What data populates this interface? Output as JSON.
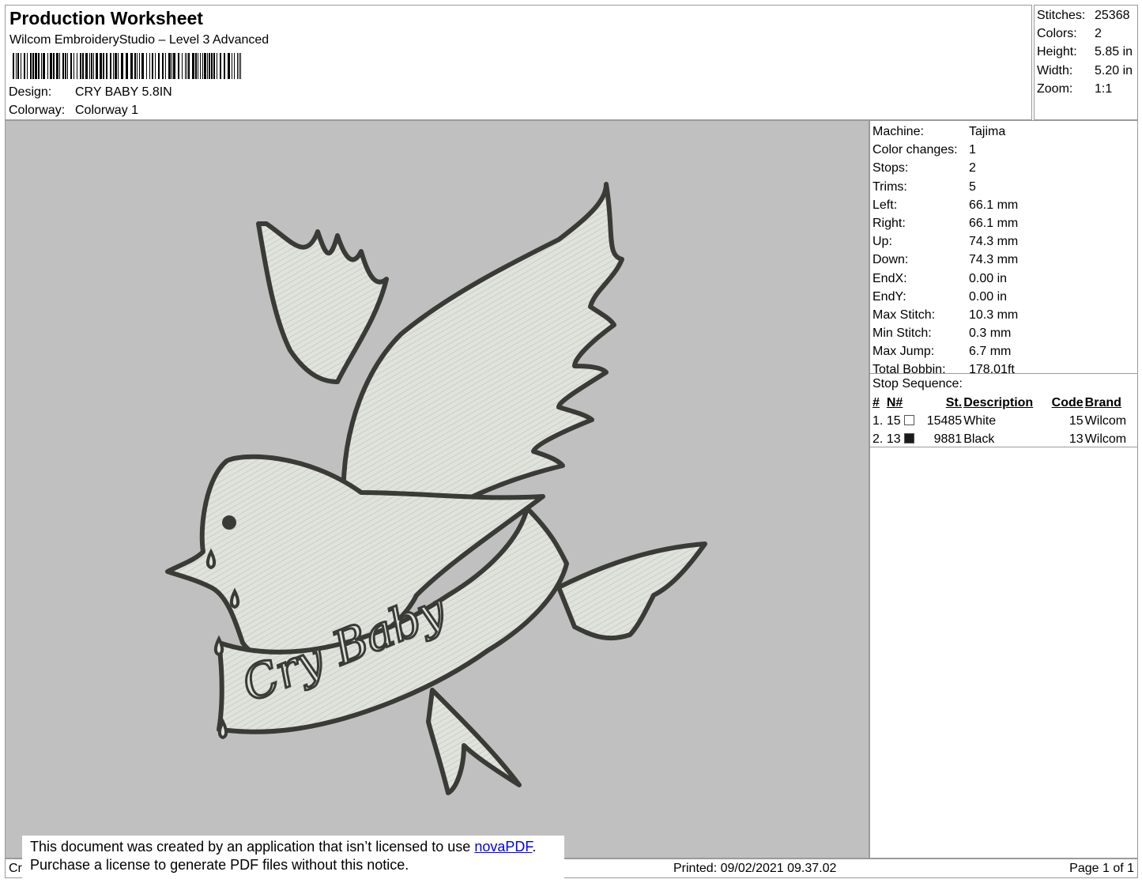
{
  "header": {
    "title": "Production Worksheet",
    "subtitle": "Wilcom EmbroideryStudio – Level 3 Advanced",
    "design_label": "Design:",
    "design_value": "CRY BABY 5.8IN",
    "colorway_label": "Colorway:",
    "colorway_value": "Colorway 1"
  },
  "summary": [
    {
      "label": "Stitches:",
      "value": "25368"
    },
    {
      "label": "Colors:",
      "value": "2"
    },
    {
      "label": "Height:",
      "value": "5.85 in"
    },
    {
      "label": "Width:",
      "value": "5.20 in"
    },
    {
      "label": "Zoom:",
      "value": "1:1"
    }
  ],
  "specs": [
    {
      "label": "Machine:",
      "value": "Tajima"
    },
    {
      "label": "Color changes:",
      "value": "1"
    },
    {
      "label": "Stops:",
      "value": "2"
    },
    {
      "label": "Trims:",
      "value": "5"
    },
    {
      "label": "Left:",
      "value": "66.1 mm"
    },
    {
      "label": "Right:",
      "value": "66.1 mm"
    },
    {
      "label": "Up:",
      "value": "74.3 mm"
    },
    {
      "label": "Down:",
      "value": "74.3 mm"
    },
    {
      "label": "EndX:",
      "value": "0.00 in"
    },
    {
      "label": "EndY:",
      "value": "0.00 in"
    },
    {
      "label": "Max Stitch:",
      "value": "10.3 mm"
    },
    {
      "label": "Min Stitch:",
      "value": "0.3 mm"
    },
    {
      "label": "Max Jump:",
      "value": "6.7 mm"
    },
    {
      "label": "Total Bobbin:",
      "value": "178.01ft"
    }
  ],
  "stop_sequence": {
    "title": "Stop Sequence:",
    "columns": [
      "#",
      "N#",
      "St.",
      "Description",
      "Code",
      "Brand"
    ],
    "rows": [
      {
        "index": "1.",
        "n": "15",
        "swatch": "#ffffff",
        "stitches": "15485",
        "description": "White",
        "code": "15",
        "brand": "Wilcom"
      },
      {
        "index": "2.",
        "n": "13",
        "swatch": "#1a1a1a",
        "stitches": "9881",
        "description": "Black",
        "code": "13",
        "brand": "Wilcom"
      }
    ]
  },
  "design": {
    "banner_text": "Cry Baby",
    "canvas_color": "#c0c0c0",
    "fill_color": "#dfe3dc",
    "outline_color": "#3a3a36"
  },
  "footer": {
    "left_text": "Cr",
    "printed": "Printed: 09/02/2021 09.37.02",
    "page": "Page 1 of 1"
  },
  "notice": {
    "line1_prefix": "This document was created by an application that isn’t licensed to use ",
    "link_text": "novaPDF",
    "line1_suffix": ".",
    "line2": "Purchase a license to generate PDF files without this notice."
  }
}
